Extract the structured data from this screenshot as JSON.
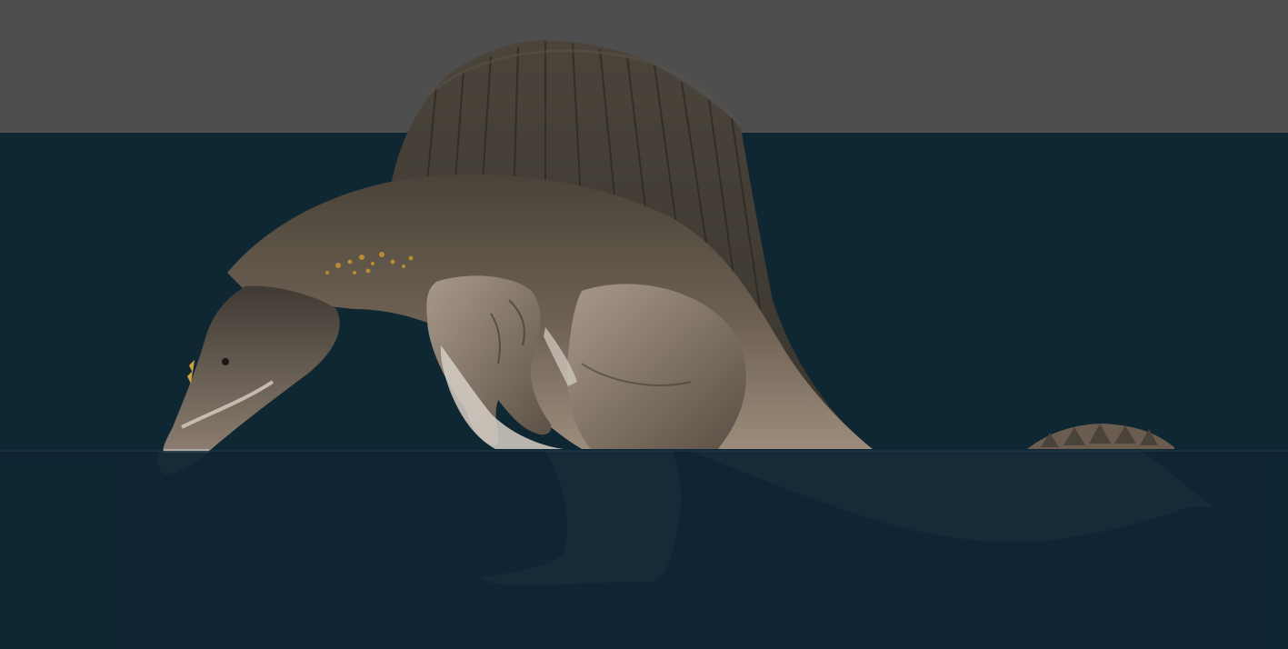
{
  "scene": {
    "subject_icon": "spinosaurus-icon",
    "colors": {
      "sky": "#4e4e4e",
      "water": "#0f2633",
      "skin_dark": "#3e3a33",
      "skin_mid": "#6b5f52",
      "skin_light": "#b8a898",
      "belly": "#d6cfc6",
      "speckle": "#c8962e"
    }
  }
}
